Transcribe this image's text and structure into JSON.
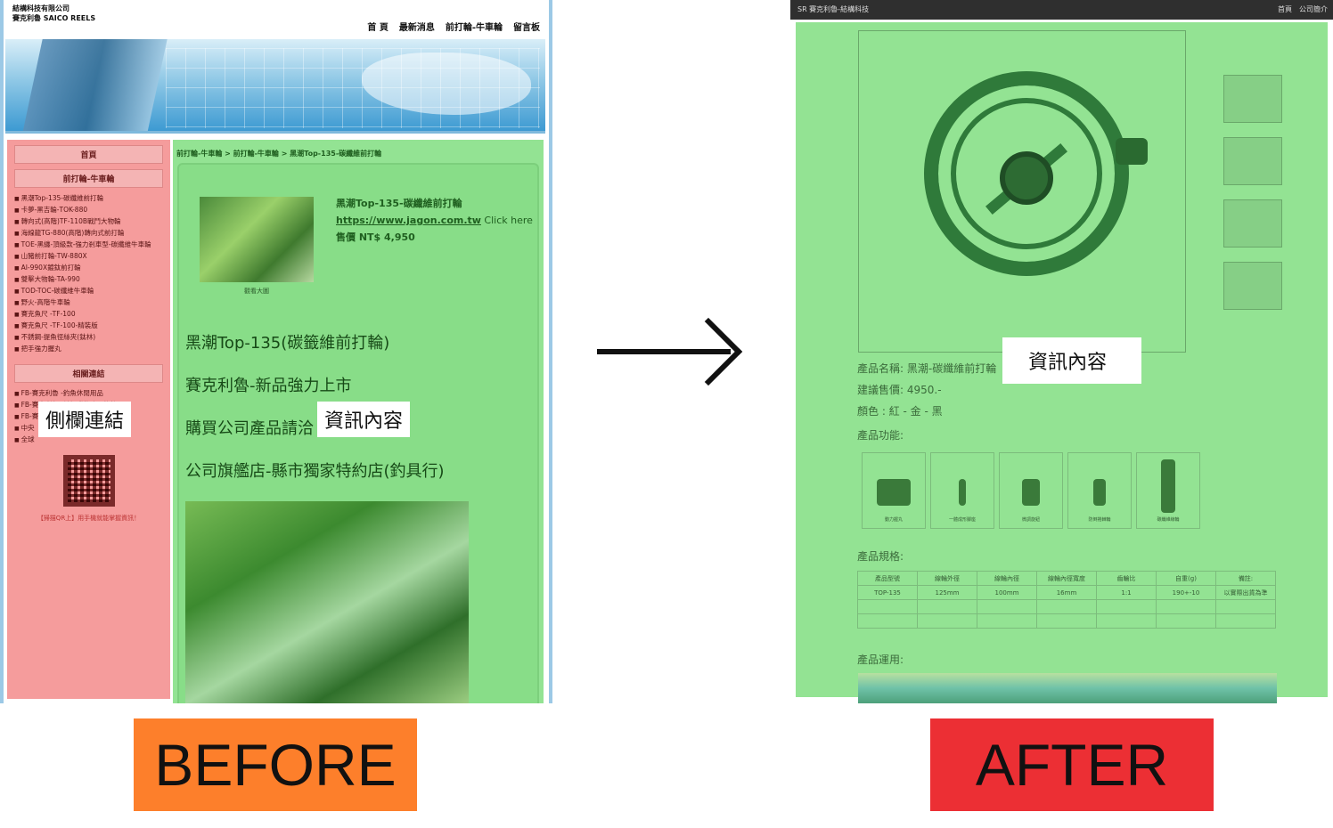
{
  "before": {
    "company_line1": "結構科技有限公司",
    "company_line2": "賽克利魯 SAICO REELS",
    "nav": [
      "首 頁",
      "最新消息",
      "前打輪-牛車輪",
      "留言板"
    ],
    "sidebar": {
      "home": "首頁",
      "category": "前打輪-牛車輪",
      "products": [
        "黑潮Top-135-碳纖維前打輪",
        "卡夢-黑吉輪-TOK-880",
        "轉向式(高階)TF-110B戰鬥大物輪",
        "海線龍TG-880(高階)轉向式前打輪",
        "TOE-黑纏-頂級款-強力剎車型-碳纖維牛車輪",
        "山豬前打輪-TW-880X",
        "AI-990X鍍鈦前打輪",
        "雙擊大物輪-TA-990",
        "TOD-TOC-碳纖維牛車輪",
        "野火-高階牛車輪",
        "賽克魚尺 -TF-100",
        "賽克魚尺 -TF-100-精裝版",
        "不銹鋼-提魚徑絲夾(鈦林)",
        "把手強力握丸"
      ],
      "links_head": "相關連結",
      "links": [
        "FB-賽克利魯 -釣魚休閒用品",
        "FB-賽克利魯 -前打磯釣路亞釣絲團",
        "FB-賽克利魯專屬團-前打技術分享",
        "中央",
        "全球"
      ],
      "qr_note": "【掃描QR上】用手機就能掌握資訊！"
    },
    "breadcrumb": "前打輪-牛車輪  >  前打輪-牛車輪  >  黑潮Top-135-碳纖維前打輪",
    "thumb_caption": "觀看大圖",
    "product_name": "黑潮Top-135-碳纖維前打輪",
    "product_link": "https://www.jagon.com.tw",
    "product_link_suffix": " Click here",
    "product_price": "售價 NT$ 4,950",
    "lines": [
      "黑潮Top-135(碳籤維前打輪)",
      "賽克利魯-新品強力上市",
      "購買公司產品請洽",
      "公司旗艦店-縣市獨家特約店(釣具行)"
    ],
    "label_sidebar": "側欄連結",
    "label_content": "資訊內容"
  },
  "after": {
    "topbar_title": "SR 賽克利魯-結構科技",
    "topbar_nav": [
      "首頁",
      "公司簡介"
    ],
    "product_name_line": "產品名稱:  黑潮-碳纖維前打輪",
    "price_line": "建議售價:  4950.-",
    "color_line": "顏色 : 紅 - 金 - 黑",
    "features_head": "產品功能:",
    "features": [
      "動力握丸",
      "一體成形腳座",
      "微調旋鈕",
      "防倒捲棘輪",
      "碳纖維線輪"
    ],
    "spec_head": "產品規格:",
    "spec_headers": [
      "產品型號",
      "線輪外徑",
      "線輪內徑",
      "線輪內徑寬度",
      "齒輪比",
      "自重(g)",
      "備註:"
    ],
    "spec_row": [
      "TOP-135",
      "125mm",
      "100mm",
      "16mm",
      "1:1",
      "190+-10",
      "以實際出貨為準"
    ],
    "usage_head": "產品運用:",
    "label_content": "資訊內容"
  },
  "tags": {
    "before": "BEFORE",
    "after": "AFTER"
  },
  "colors": {
    "sidebar_overlay": "#f59c9c",
    "content_overlay": "#93e393",
    "before_tag": "#fd7f2b",
    "after_tag": "#ec2f34"
  }
}
